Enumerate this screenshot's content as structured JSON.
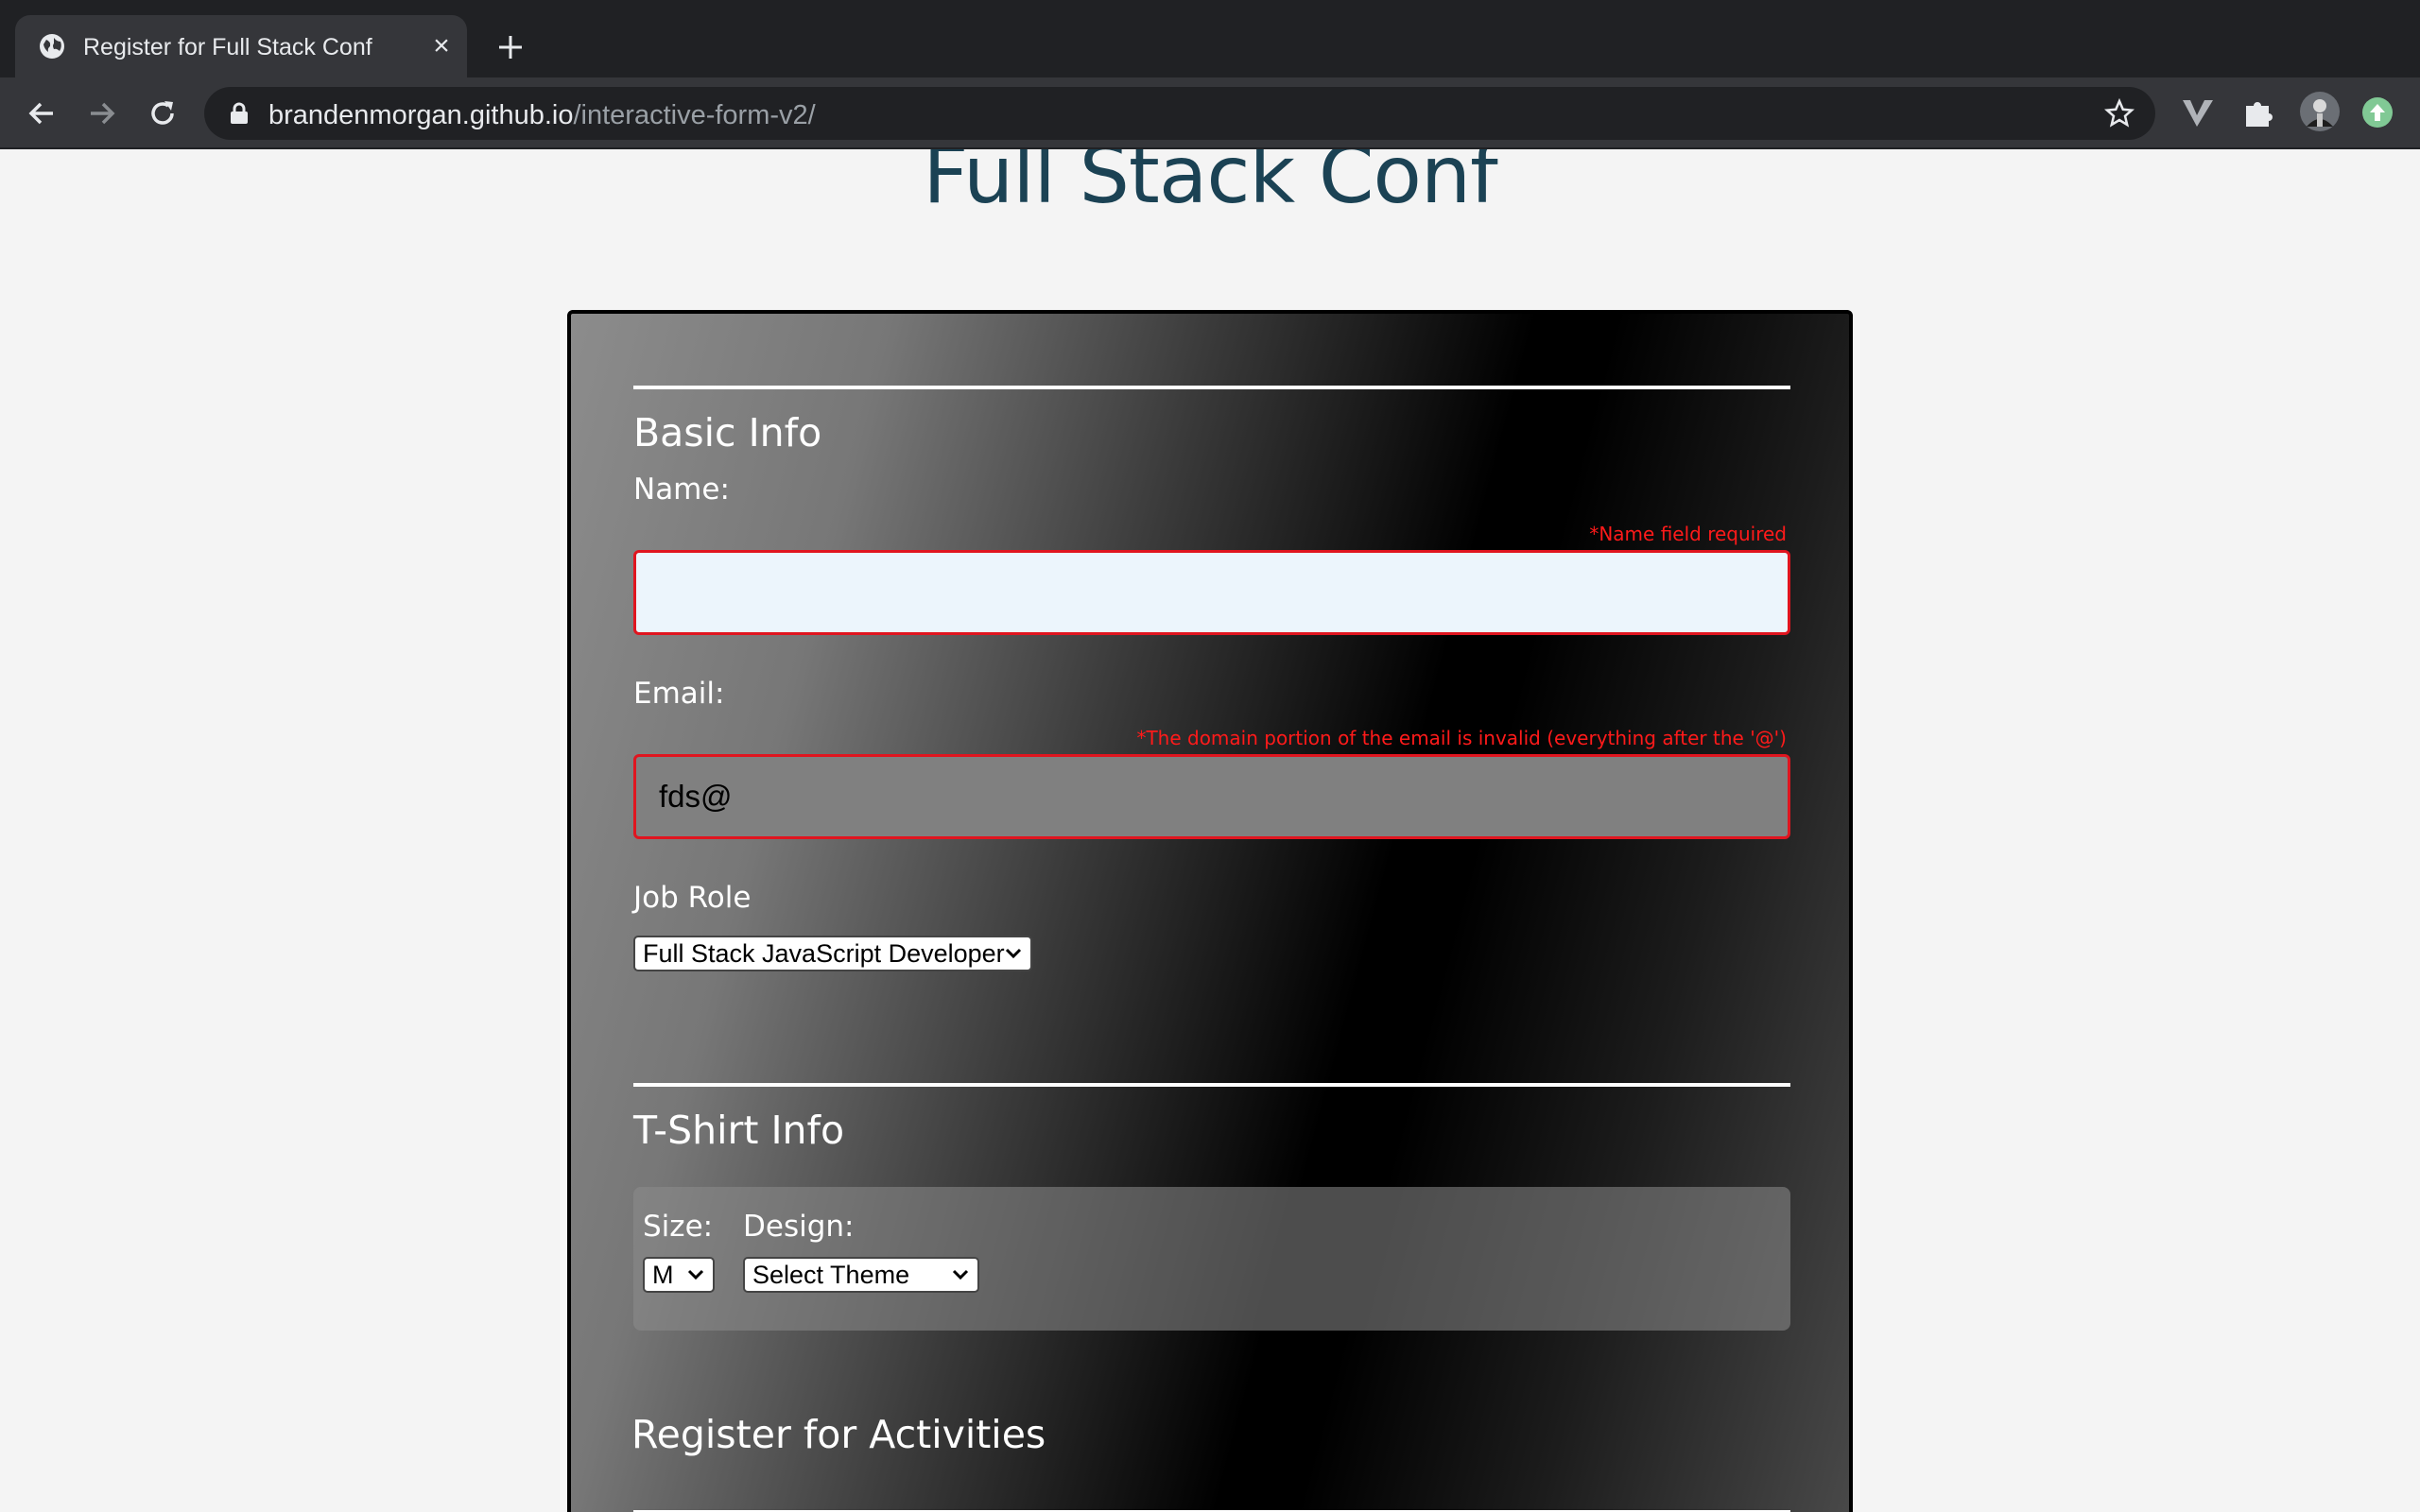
{
  "browser": {
    "tab_title": "Register for Full Stack Conf",
    "url_host": "brandenmorgan.github.io",
    "url_path": "/interactive-form-v2/"
  },
  "page": {
    "title": "Full Stack Conf"
  },
  "form": {
    "basic_info": {
      "heading": "Basic Info",
      "name_label": "Name:",
      "name_error": "*Name field required",
      "name_value": "",
      "email_label": "Email:",
      "email_error": "*The domain portion of the email is invalid (everything after the '@')",
      "email_value": "fds@",
      "job_role_label": "Job Role",
      "job_role_selected": "Full Stack JavaScript Developer"
    },
    "tshirt_info": {
      "heading": "T-Shirt Info",
      "size_label": "Size:",
      "size_selected": "M",
      "design_label": "Design:",
      "design_selected": "Select Theme"
    },
    "activities": {
      "heading": "Register for Activities"
    }
  },
  "colors": {
    "title": "#1b4254",
    "error": "#ff1a1a",
    "error_border": "#e0151f"
  },
  "icons": [
    "globe-icon",
    "close-icon",
    "plus-icon",
    "back-arrow-icon",
    "forward-arrow-icon",
    "reload-icon",
    "lock-icon",
    "star-icon",
    "vuetify-icon",
    "puzzle-icon",
    "avatar",
    "update-icon",
    "chevron-down-icon"
  ]
}
